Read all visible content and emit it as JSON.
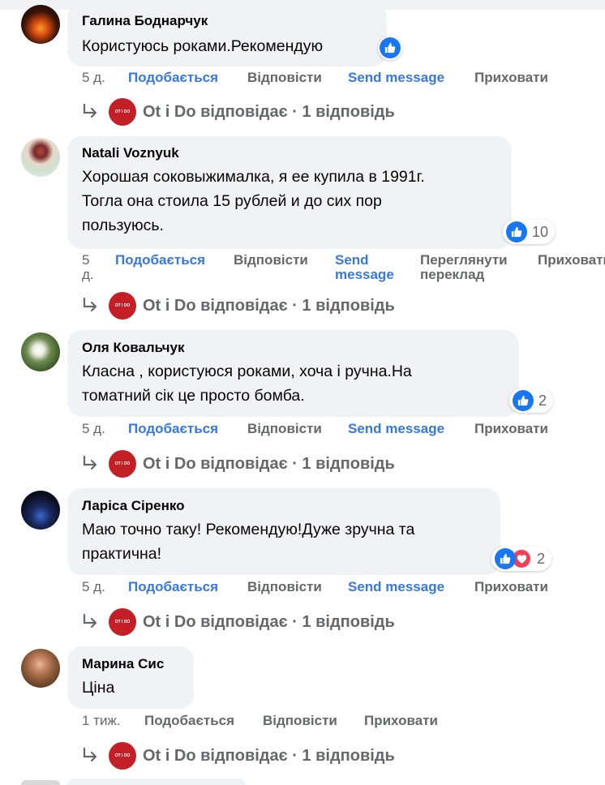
{
  "comments": [
    {
      "author": "Галина Боднарчук",
      "text": "Користуюсь роками.Рекомендую",
      "reactions": {
        "types": [
          "like"
        ],
        "count": ""
      },
      "time": "5 д.",
      "like": "Подобається",
      "reply": "Відповісти",
      "send": "Send message",
      "translate": "",
      "hide": "Приховати",
      "page_reply": {
        "page": "Ot i Do",
        "text": "Ot i Do відповідає · 1 відповідь"
      }
    },
    {
      "author": "Natali Voznyuk",
      "text": "Хорошая соковыжималка, я ее купила в 1991г.\nТогла она стоила 15 рублей и до сих пор\nпользуюсь.",
      "reactions": {
        "types": [
          "like"
        ],
        "count": "10"
      },
      "time": "5\nд.",
      "like": "Подобається",
      "reply": "Відповісти",
      "send": "Send\nmessage",
      "translate": "Переглянути\nпереклад",
      "hide": "Приховати",
      "page_reply": {
        "page": "Ot i Do",
        "text": "Ot i Do відповідає · 1 відповідь"
      }
    },
    {
      "author": "Оля Ковальчук",
      "text": "Класна , користуюся роками, хоча і ручна.На\nтоматний сік це просто бомба.",
      "reactions": {
        "types": [
          "like"
        ],
        "count": "2"
      },
      "time": "5 д.",
      "like": "Подобається",
      "reply": "Відповісти",
      "send": "Send message",
      "translate": "",
      "hide": "Приховати",
      "page_reply": {
        "page": "Ot i Do",
        "text": "Ot i Do відповідає · 1 відповідь"
      }
    },
    {
      "author": "Ларіса Сіренко",
      "text": "Маю точно таку! Рекомендую!Дуже зручна та\nпрактична!",
      "reactions": {
        "types": [
          "like",
          "love"
        ],
        "count": "2"
      },
      "time": "5 д.",
      "like": "Подобається",
      "reply": "Відповісти",
      "send": "Send message",
      "translate": "",
      "hide": "Приховати",
      "page_reply": {
        "page": "Ot i Do",
        "text": "Ot i Do відповідає · 1 відповідь"
      }
    },
    {
      "author": "Марина Сис",
      "text": "Ціна",
      "reactions": {
        "types": [],
        "count": ""
      },
      "time": "1 тиж.",
      "like": "Подобається",
      "reply": "Відповісти",
      "send": "",
      "translate": "",
      "hide": "Приховати",
      "page_reply": {
        "page": "Ot i Do",
        "text": "Ot i Do відповідає · 1 відповідь"
      }
    }
  ],
  "colors": {
    "like_blue": "#1877f2",
    "love_red": "#f33e58",
    "link_blue": "#3578e5",
    "meta_gray": "#65676b",
    "bubble_gray": "#f0f2f5",
    "page_red": "#c41e26"
  },
  "icons": {
    "like": "thumbs-up-icon",
    "love": "heart-icon",
    "reply": "reply-arrow-icon"
  }
}
